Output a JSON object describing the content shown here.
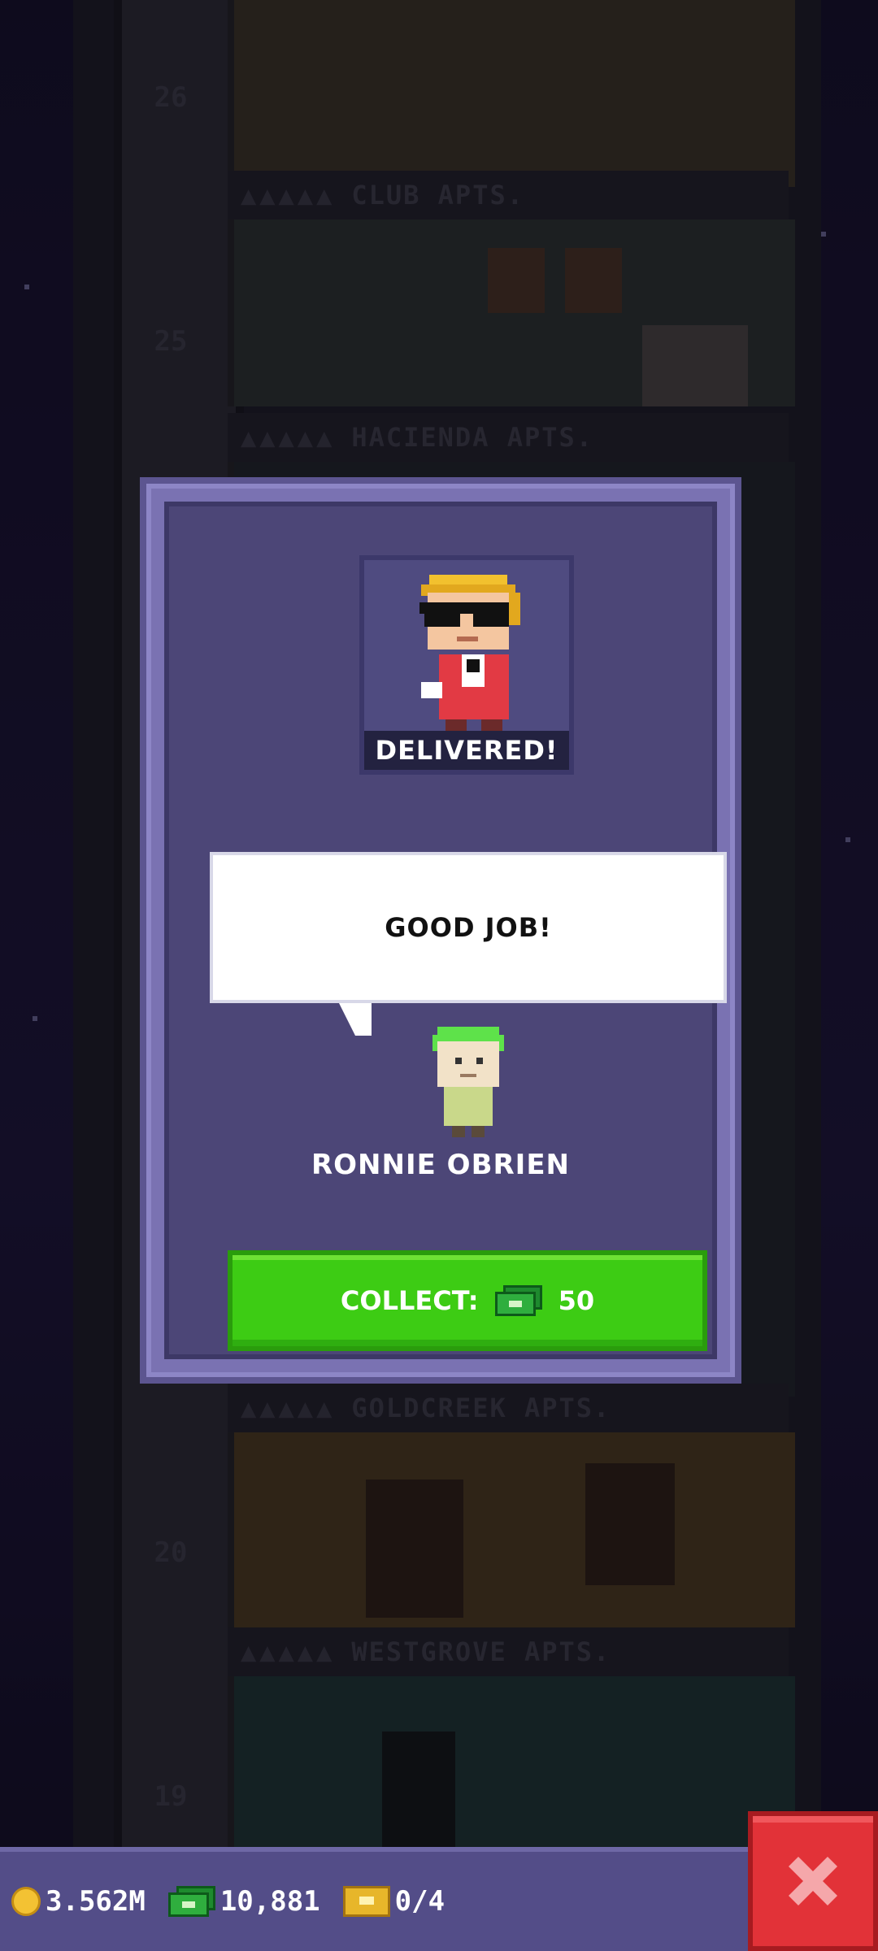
{
  "background": {
    "floors": [
      {
        "number": "26",
        "sign": "CLUB APTS."
      },
      {
        "number": "25",
        "sign": "HACIENDA APTS."
      },
      {
        "number": "",
        "sign": "GOLDCREEK APTS."
      },
      {
        "number": "20",
        "sign": "WESTGROVE APTS."
      },
      {
        "number": "19",
        "sign": ""
      }
    ],
    "sign_dots": "▲▲▲▲▲"
  },
  "modal": {
    "status_label": "DELIVERED!",
    "speech": "GOOD JOB!",
    "speaker_name": "RONNIE OBRIEN",
    "collect_label": "COLLECT:",
    "collect_amount": "50",
    "collect_icon": "cash-icon"
  },
  "bottom_bar": {
    "coins": "3.562M",
    "coins_icon": "coin-icon",
    "bux": "10,881",
    "bux_icon": "cash-icon",
    "tickets": "0/4",
    "tickets_icon": "ticket-icon",
    "close_icon": "close-icon"
  },
  "colors": {
    "modal_bg": "#4c4677",
    "collect_green": "#3dcc14",
    "close_red": "#e23238",
    "bar_bg": "#534d88"
  }
}
